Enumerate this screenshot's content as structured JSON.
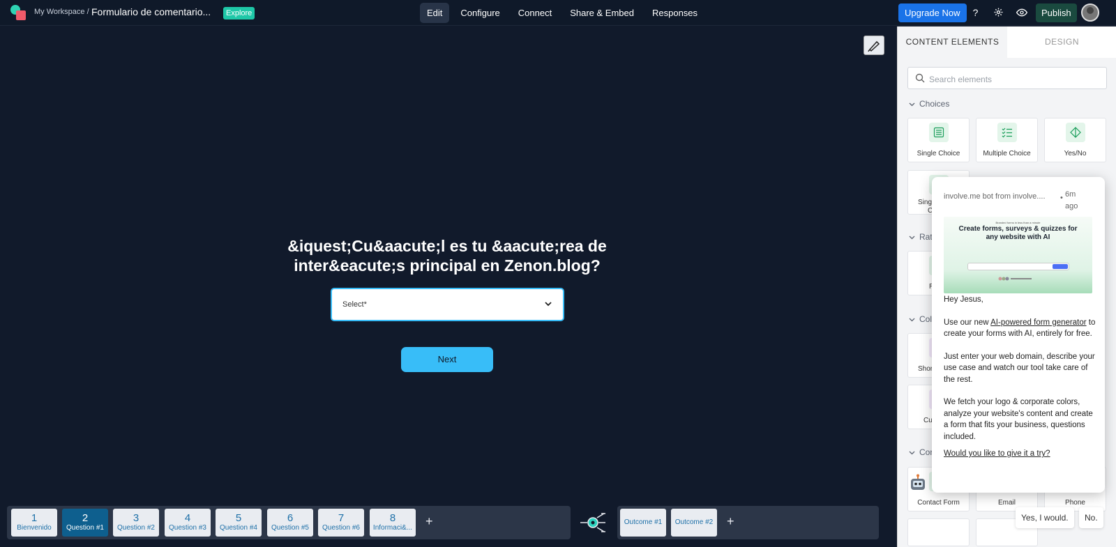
{
  "topbar": {
    "workspace": "My Workspace /",
    "form_name": "Formulario de comentario...",
    "explore_badge": "Explore",
    "nav": [
      "Edit",
      "Configure",
      "Connect",
      "Share & Embed",
      "Responses"
    ],
    "upgrade": "Upgrade Now",
    "publish": "Publish"
  },
  "canvas": {
    "question": "&iquest;Cu&aacute;l es tu &aacute;rea de inter&eacute;s principal en Zenon.blog?",
    "select_placeholder": "Select*",
    "next_button": "Next"
  },
  "pages": [
    {
      "num": "1",
      "label": "Bienvenido"
    },
    {
      "num": "2",
      "label": "Question #1"
    },
    {
      "num": "3",
      "label": "Question #2"
    },
    {
      "num": "4",
      "label": "Question #3"
    },
    {
      "num": "5",
      "label": "Question #4"
    },
    {
      "num": "6",
      "label": "Question #5"
    },
    {
      "num": "7",
      "label": "Question #6"
    },
    {
      "num": "8",
      "label": "Informaci&..."
    }
  ],
  "outcomes": [
    "Outcome #1",
    "Outcome #2"
  ],
  "panel": {
    "tabs": [
      "CONTENT ELEMENTS",
      "DESIGN"
    ],
    "search_placeholder": "Search elements",
    "sections": {
      "choices": "Choices",
      "ratings": "Rati",
      "collect": "Coll",
      "contact": "Con"
    },
    "choices": [
      "Single Choice",
      "Multiple Choice",
      "Yes/No"
    ],
    "partial_labels": {
      "single_c": "Singl",
      "single_c2": "Cl",
      "r": "R",
      "short": "Short",
      "cu": "Cu",
      "contact_form": "Contact Form",
      "email": "Email",
      "phone": "Phone"
    }
  },
  "chat": {
    "from": "involve.me bot from involve....",
    "dot": "•",
    "time": "6m ago",
    "img_small": "Branded forms in less than a minute",
    "img_head": "Create forms, surveys & quizzes for any website with AI",
    "greeting": "Hey Jesus,",
    "p1_a": "Use our new ",
    "p1_link": "AI-powered form generator",
    "p1_b": " to create your forms with AI, entirely for free.",
    "p2": "Just enter your web domain, describe your use case and watch our tool take care of the rest.",
    "p3": "We fetch your logo & corporate colors, analyze your website's content and create a form that fits your business, questions included.",
    "p4_link": "Would you like to give it a try?",
    "reply_yes": "Yes, I would.",
    "reply_no": "No."
  }
}
